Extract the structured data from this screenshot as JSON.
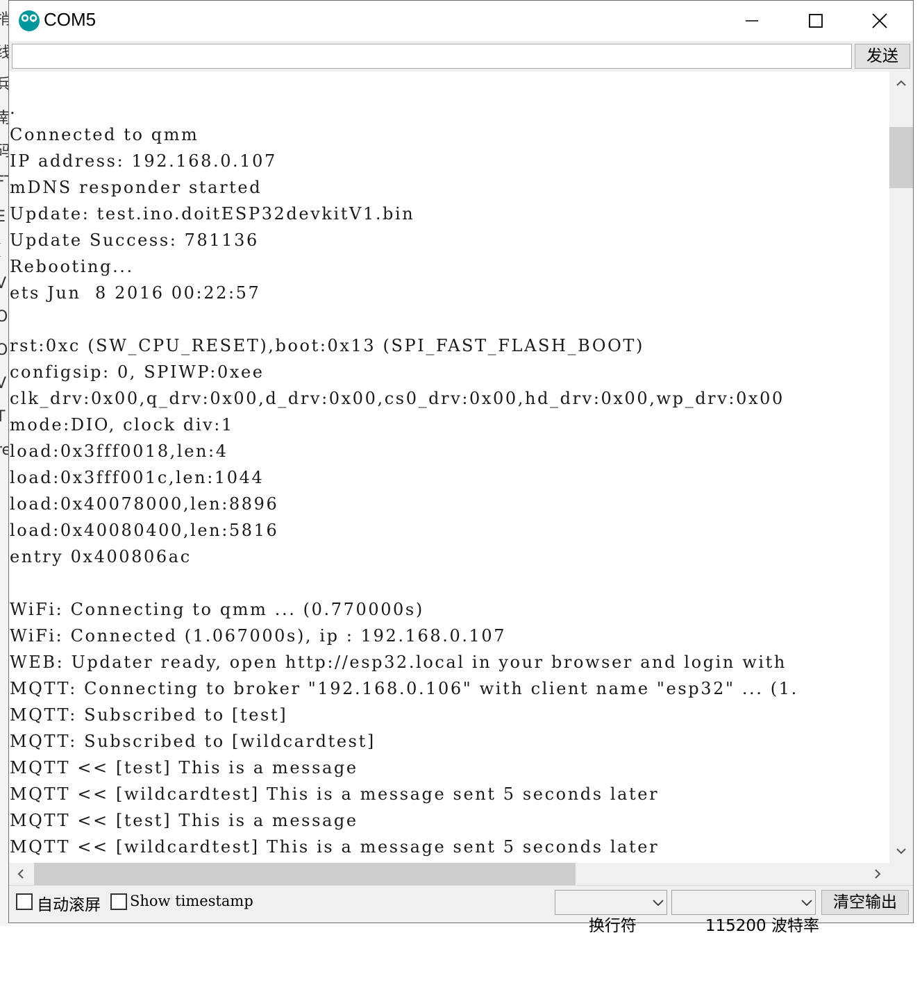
{
  "background_window": {
    "edge_glyphs": [
      "捎",
      "线",
      "兵",
      "南",
      "码",
      "FT",
      "E",
      "(",
      "V",
      "OF",
      "OF",
      "V",
      "T",
      "re"
    ]
  },
  "window": {
    "title": "COM5",
    "app_icon": "arduino-infinity-icon",
    "controls": {
      "minimize": "minimize-icon",
      "maximize": "maximize-icon",
      "close": "close-icon"
    }
  },
  "send_bar": {
    "input_value": "",
    "send_label": "发送"
  },
  "output": {
    "lines": [
      ".",
      "Connected to qmm",
      "IP address: 192.168.0.107",
      "mDNS responder started",
      "Update: test.ino.doitESP32devkitV1.bin",
      "Update Success: 781136",
      "Rebooting...",
      "ets Jun  8 2016 00:22:57",
      "",
      "rst:0xc (SW_CPU_RESET),boot:0x13 (SPI_FAST_FLASH_BOOT)",
      "configsip: 0, SPIWP:0xee",
      "clk_drv:0x00,q_drv:0x00,d_drv:0x00,cs0_drv:0x00,hd_drv:0x00,wp_drv:0x00",
      "mode:DIO, clock div:1",
      "load:0x3fff0018,len:4",
      "load:0x3fff001c,len:1044",
      "load:0x40078000,len:8896",
      "load:0x40080400,len:5816",
      "entry 0x400806ac",
      "",
      "WiFi: Connecting to qmm ... (0.770000s)",
      "WiFi: Connected (1.067000s), ip : 192.168.0.107",
      "WEB: Updater ready, open http://esp32.local in your browser and login with",
      "MQTT: Connecting to broker \"192.168.0.106\" with client name \"esp32\" ... (1.",
      "MQTT: Subscribed to [test]",
      "MQTT: Subscribed to [wildcardtest]",
      "MQTT << [test] This is a message",
      "MQTT << [wildcardtest] This is a message sent 5 seconds later",
      "MQTT << [test] This is a message",
      "MQTT << [wildcardtest] This is a message sent 5 seconds later"
    ]
  },
  "bottom_bar": {
    "autoscroll_label": "自动滚屏",
    "autoscroll_checked": false,
    "timestamp_label": "Show timestamp",
    "timestamp_checked": false,
    "line_ending_value": "换行符",
    "baud_value": "115200 波特率",
    "clear_label": "清空输出"
  },
  "colors": {
    "title_bar": "#ffffff",
    "chrome": "#f0f0f0",
    "icon_teal": "#00979c",
    "scroll_thumb": "#cdcdcd"
  }
}
